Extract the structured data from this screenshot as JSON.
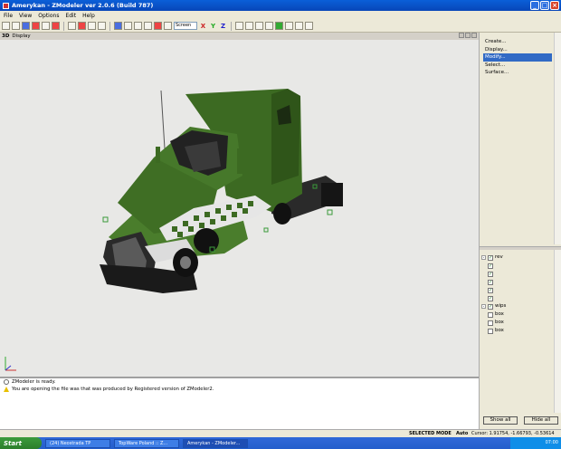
{
  "window": {
    "title": "Amerykan - ZModeler ver 2.0.6 (Build 787)"
  },
  "menu": [
    "File",
    "View",
    "Options",
    "Edit",
    "Help"
  ],
  "toolbar": {
    "coord_space": "Screen",
    "axes": [
      "X",
      "Y",
      "Z"
    ]
  },
  "viewport": {
    "mode": "3D",
    "label": "Display"
  },
  "commands": {
    "items": [
      "Create...",
      "Display...",
      "Modify...",
      "Select...",
      "Surface..."
    ],
    "selected": "Modify..."
  },
  "tree": {
    "items": [
      {
        "label": "rev",
        "checked": true,
        "expander": "-"
      },
      {
        "label": "",
        "checked": true
      },
      {
        "label": "",
        "checked": true
      },
      {
        "label": "",
        "checked": true
      },
      {
        "label": "",
        "checked": true
      },
      {
        "label": "",
        "checked": true
      },
      {
        "label": "wips",
        "checked": true,
        "expander": "-"
      },
      {
        "label": "box",
        "checked": false
      },
      {
        "label": "box",
        "checked": false
      },
      {
        "label": "box",
        "checked": false
      }
    ],
    "show_all": "Show all",
    "hide_all": "Hide all"
  },
  "log": [
    {
      "icon": "info-icon",
      "text": "ZModeler is ready."
    },
    {
      "icon": "warning-icon",
      "text": "You are opening the file was that was produced by Registered version of ZModeler2."
    }
  ],
  "status": {
    "mode": "SELECTED MODE",
    "auto": "Auto",
    "cursor": "Cursor: 1.91754, -1.66793, -0.53614"
  },
  "taskbar": {
    "start": "Start",
    "tasks": [
      "(24) Neostrada TP",
      "TopWare Poland :: Z...",
      "Amerykan - ZModeler..."
    ],
    "clock": "07:00"
  },
  "colors": {
    "truck_body": "#3c6a22",
    "selection": "#316ac5"
  }
}
